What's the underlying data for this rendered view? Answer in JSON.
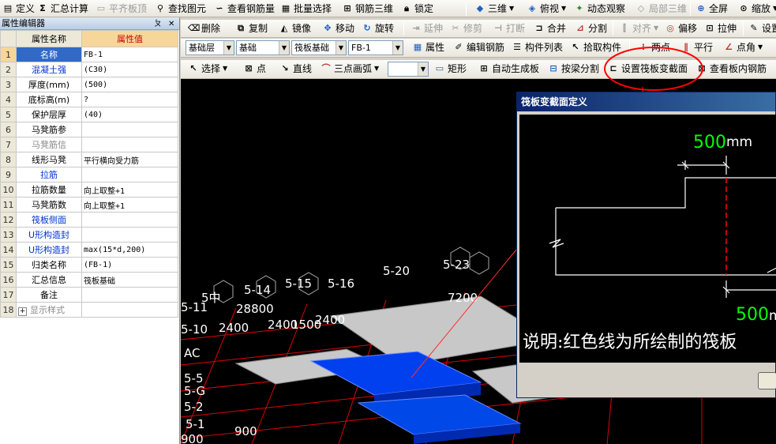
{
  "toolbar1": {
    "define": "定义",
    "summary": "汇总计算",
    "flush_top": "平齐板顶",
    "find_element": "查找图元",
    "view_rebar": "查看钢筋量",
    "batch_select": "批量选择",
    "rebar_3d": "钢筋三维",
    "lock": "锁定",
    "view_3d": "三维",
    "top_view": "俯视",
    "dynamic_observe": "动态观察",
    "local_3d": "局部三维",
    "fullscreen": "全屏",
    "zoom": "缩放"
  },
  "toolbar2": {
    "delete": "删除",
    "copy": "复制",
    "mirror": "镜像",
    "move": "移动",
    "rotate": "旋转",
    "extend": "延伸",
    "trim": "修剪",
    "break": "打断",
    "merge": "合并",
    "split": "分割",
    "align": "对齐",
    "offset": "偏移",
    "stretch": "拉伸",
    "settings": "设置"
  },
  "toolbar3": {
    "layer": "基础层",
    "category": "基础",
    "type": "筏板基础",
    "component": "FB-1",
    "properties": "属性",
    "edit_rebar": "编辑钢筋",
    "component_list": "构件列表",
    "pick_component": "拾取构件",
    "two_points": "两点",
    "parallel": "平行",
    "point_angle": "点角"
  },
  "toolbar4": {
    "select": "选择",
    "point": "点",
    "line": "直线",
    "arc": "三点画弧",
    "rect": "矩形",
    "auto_generate": "自动生成板",
    "split_by_beam": "按梁分割",
    "set_section": "设置筏板变截面",
    "view_rebar_in_slab": "查看板内钢筋"
  },
  "panel": {
    "title": "属性编辑器",
    "pin": "ㄆ",
    "close": "✕",
    "col_name": "属性名称",
    "col_value": "属性值",
    "rows": [
      {
        "n": "1",
        "name": "名称",
        "value": "FB-1",
        "style": "sel"
      },
      {
        "n": "2",
        "name": "混凝土强",
        "value": "(C30)",
        "style": "blue"
      },
      {
        "n": "3",
        "name": "厚度(mm)",
        "value": "(500)",
        "style": ""
      },
      {
        "n": "4",
        "name": "底标高(m)",
        "value": "?",
        "style": ""
      },
      {
        "n": "5",
        "name": "保护层厚",
        "value": "(40)",
        "style": ""
      },
      {
        "n": "6",
        "name": "马凳筋参",
        "value": "",
        "style": ""
      },
      {
        "n": "7",
        "name": "马凳筋信",
        "value": "",
        "style": "gray"
      },
      {
        "n": "8",
        "name": "线形马凳",
        "value": "平行横向受力筋",
        "style": ""
      },
      {
        "n": "9",
        "name": "拉筋",
        "value": "",
        "style": "blue"
      },
      {
        "n": "10",
        "name": "拉筋数量",
        "value": "向上取整+1",
        "style": ""
      },
      {
        "n": "11",
        "name": "马凳筋数",
        "value": "向上取整+1",
        "style": ""
      },
      {
        "n": "12",
        "name": "筏板侧面",
        "value": "",
        "style": "blue"
      },
      {
        "n": "13",
        "name": "U形构造封",
        "value": "",
        "style": "blue"
      },
      {
        "n": "14",
        "name": "U形构造封",
        "value": "max(15*d,200)",
        "style": "blue"
      },
      {
        "n": "15",
        "name": "归类名称",
        "value": "(FB-1)",
        "style": ""
      },
      {
        "n": "16",
        "name": "汇总信息",
        "value": "筏板基础",
        "style": ""
      },
      {
        "n": "17",
        "name": "备注",
        "value": "",
        "style": ""
      },
      {
        "n": "18",
        "name": "显示样式",
        "value": "",
        "style": "gray"
      }
    ],
    "expand": "+"
  },
  "canvas": {
    "labels": [
      "5-20",
      "5-23",
      "5-16",
      "5-15",
      "5-14",
      "5-11",
      "5-10",
      "7200",
      "28800",
      "2400",
      "2400",
      "2400",
      "1500",
      "900",
      "AC",
      "5-5",
      "5-G",
      "5-2",
      "5-1",
      "900",
      "5中"
    ]
  },
  "dialog": {
    "title": "筏板变截面定义",
    "dim_top": "500",
    "dim_bottom": "500",
    "unit": "mm",
    "note": "说明:红色线为所绘制的筏板"
  },
  "colors": {
    "accent": "#ff0000",
    "selected": "#316ac5",
    "slab_blue": "#0044dd",
    "slab_gray": "#c8c8c8",
    "dim_green": "#00ff00"
  }
}
